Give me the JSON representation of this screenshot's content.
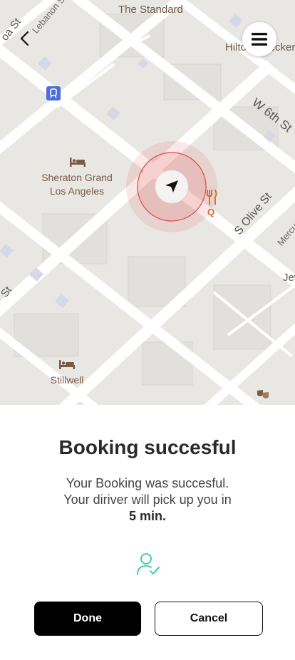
{
  "map": {
    "labels": {
      "lebanon_st": "Lebanon St",
      "standard": "The Standard",
      "hilton": "Hilton Checkers",
      "w6th": "W 6th St",
      "olive": "S Olive St",
      "mercury": "Mercury",
      "jewelry": "Jewelry",
      "left_top": "oa St",
      "left_mid": "St"
    },
    "pois": {
      "sheraton": "Sheraton Grand\nLos Angeles",
      "stillwell": "Stillwell",
      "restaurant_letter": "Q"
    }
  },
  "sheet": {
    "title": "Booking succesful",
    "message_line1": "Your Booking was succesful.",
    "message_line2": "Your diriver will pick up you in",
    "eta": "5 min.",
    "done_label": "Done",
    "cancel_label": "Cancel"
  },
  "colors": {
    "accent_green": "#2ecc9a",
    "location_red": "#e04848",
    "poi_brown": "#7a5a45",
    "restaurant_orange": "#e0661b"
  }
}
